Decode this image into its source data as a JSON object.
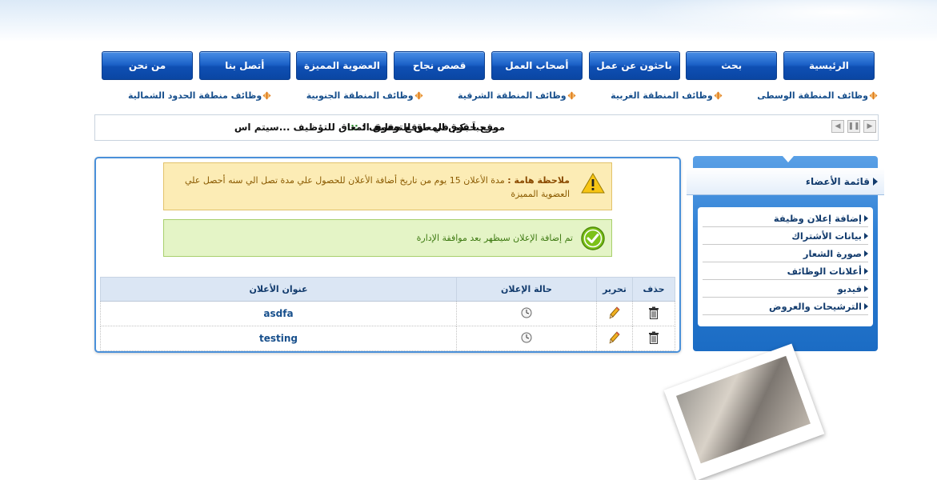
{
  "nav": {
    "items": [
      "الرئيسية",
      "بحث",
      "باحثون عن عمل",
      "أصحاب العمل",
      "قصص نجاح",
      "العضوية المميزة",
      "أتصل بنا",
      "من نحن"
    ]
  },
  "regions": [
    "وظائف المنطقة الوسطى",
    "وظائف المنطقة الغربية",
    "وظائف المنطقة الشرقية",
    "وظائف المنطقة الجنوبية",
    "وظائف منطقة الحدود الشمالية"
  ],
  "ticker": {
    "site_label": "موقع حقوق المعاق للتوظيف :",
    "separator": ":::",
    "message": "مرحباً بكم في موقع حقوق المعاق للتؤظيف ...سيتم اس",
    "controls": [
      "previous-icon",
      "pause-icon",
      "next-icon"
    ]
  },
  "notice": {
    "title": "ملاحظة هامة :",
    "text": "مدة الأعلان 15 يوم من تاريخ أضافة الأعلان للحصول علي مدة تصل الي سنه أحصل علي العضوية المميزة",
    "icon": "warning-icon"
  },
  "success": {
    "text": "تم إضافة الإعلان سيظهر بعد موافقة الإدارة",
    "icon": "check-icon"
  },
  "ads_table": {
    "headers": {
      "delete": "حذف",
      "edit": "تحرير",
      "status": "حالة الإعلان",
      "title": "عنوان الأعلان"
    },
    "rows": [
      {
        "title": "asdfa",
        "status_icon": "clock-icon"
      },
      {
        "title": "testing",
        "status_icon": "clock-icon"
      }
    ]
  },
  "sidebar": {
    "title": "قائمة الأعضاء",
    "items": [
      "إضافة إعلان وظيفة",
      "بيانات الأشتراك",
      "صورة الشعار",
      "أعلانات الوظائف",
      "فيديو",
      "الترشيحات والعروض"
    ]
  },
  "colors": {
    "nav": "#1d63c9",
    "accent": "#174f8c",
    "sidebar": "#2e7fd4",
    "warning_bg": "#fcecb5",
    "success_bg": "#e4f4c6"
  }
}
